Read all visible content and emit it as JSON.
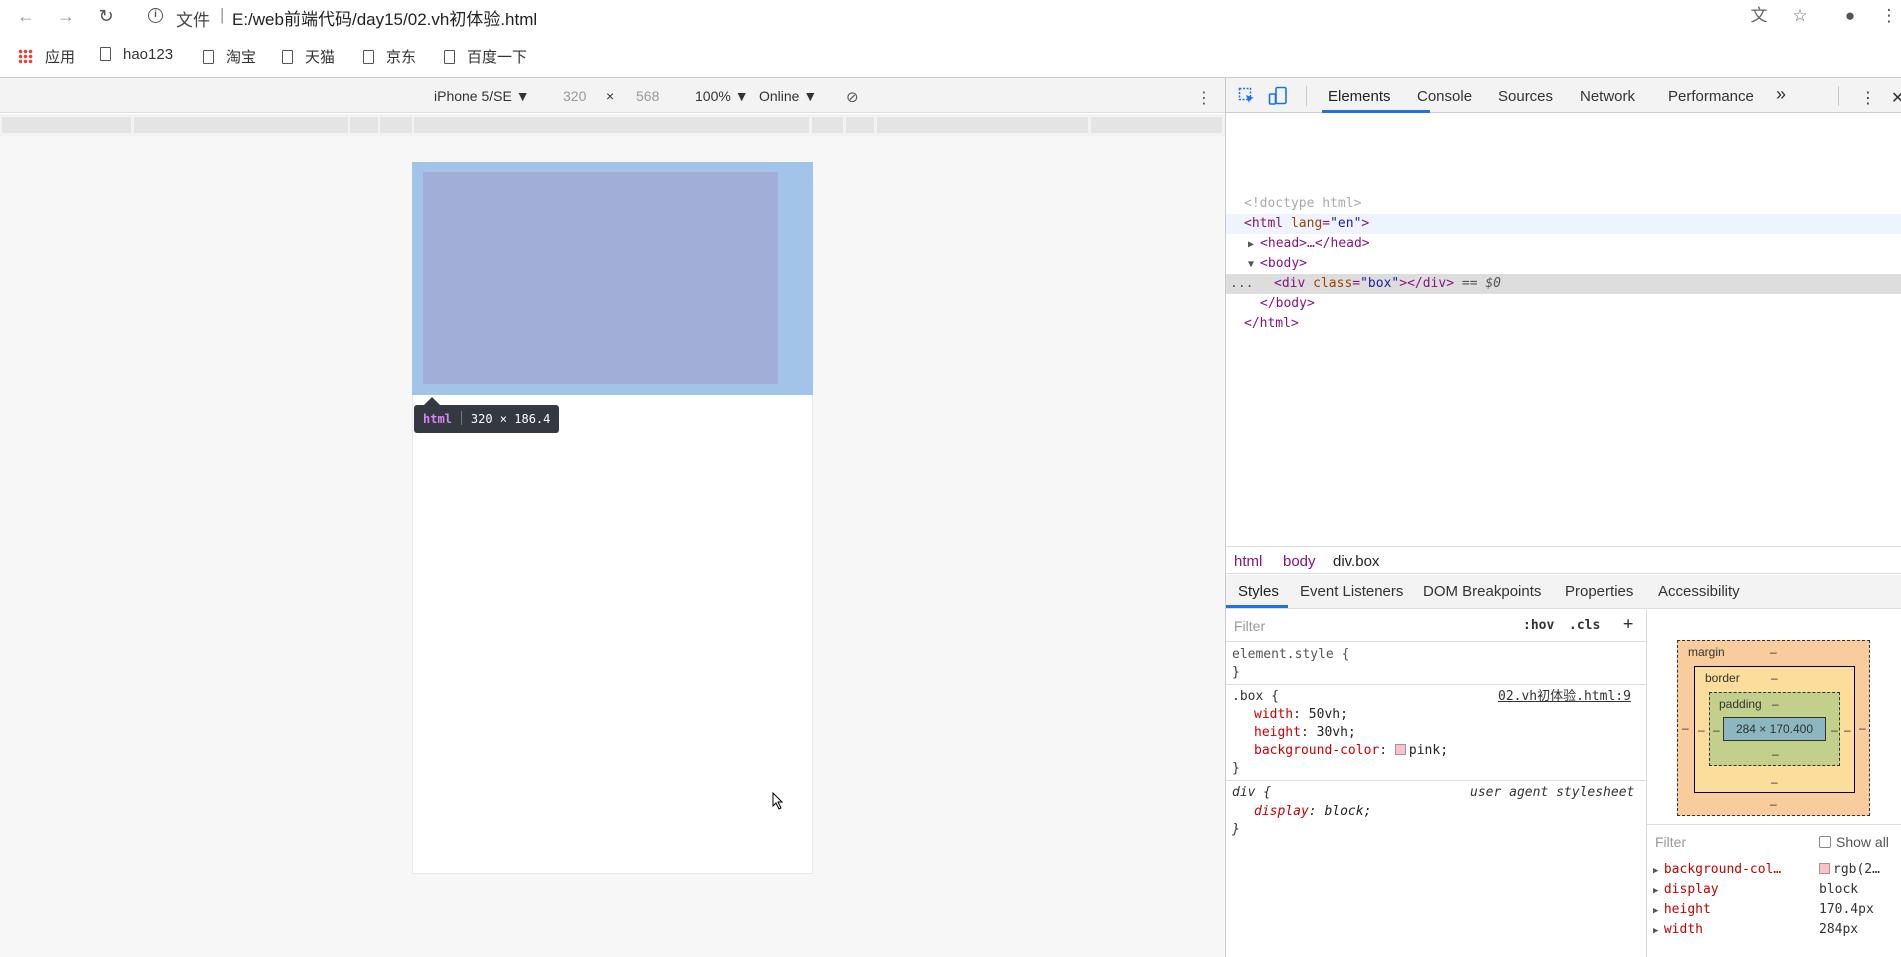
{
  "browser": {
    "file_label": "文件",
    "url": "E:/web前端代码/day15/02.vh初体验.html"
  },
  "bookmarks": [
    {
      "label": "应用"
    },
    {
      "label": "hao123"
    },
    {
      "label": "淘宝"
    },
    {
      "label": "天猫"
    },
    {
      "label": "京东"
    },
    {
      "label": "百度一下"
    }
  ],
  "device_toolbar": {
    "device": "iPhone 5/SE ▼",
    "width": "320",
    "times": "×",
    "height": "568",
    "zoom": "100% ▼",
    "network": "Online ▼"
  },
  "tooltip": {
    "tag": "html",
    "size": "320 × 186.4"
  },
  "devtools": {
    "tabs": [
      "Elements",
      "Console",
      "Sources",
      "Network",
      "Performance"
    ],
    "more": "»",
    "dom_lines": {
      "doctype": "<!doctype html>",
      "html_open": "<html ",
      "html_attr": "lang",
      "html_val": "\"en\"",
      "head": "<head>…</head>",
      "body_open": "<body>",
      "div_open": "<div ",
      "div_attr": "class",
      "div_val": "\"box\"",
      "div_close": "></div>",
      "dollar": " == $0",
      "ellipsis": "...",
      "body_close": "</body>",
      "html_close": "</html>"
    },
    "breadcrumbs": [
      "html",
      "body",
      "div.box"
    ],
    "subtabs": [
      "Styles",
      "Event Listeners",
      "DOM Breakpoints",
      "Properties",
      "Accessibility"
    ],
    "styles": {
      "filter_placeholder": "Filter",
      "hov": ":hov",
      "cls": ".cls",
      "add": "+",
      "element_style": "element.style {",
      "close_brace": "}",
      "box_selector": ".box {",
      "box_source": "02.vh初体验.html:9",
      "box_props": [
        {
          "name": "width",
          "value": "50vh;"
        },
        {
          "name": "height",
          "value": "30vh;"
        },
        {
          "name": "background-color",
          "value": "pink;"
        }
      ],
      "div_selector": "div {",
      "div_source": "user agent stylesheet",
      "div_prop": {
        "name": "display",
        "value": "block;"
      }
    },
    "box_model": {
      "margin": "margin",
      "border": "border",
      "padding": "padding",
      "content": "284 × 170.400",
      "dash": "–"
    },
    "computed": {
      "filter_placeholder": "Filter",
      "show_all": "Show all",
      "rows": [
        {
          "name": "background-col…",
          "value": "rgb(2…"
        },
        {
          "name": "display",
          "value": "block"
        },
        {
          "name": "height",
          "value": "170.4px"
        },
        {
          "name": "width",
          "value": "284px"
        }
      ]
    }
  },
  "colors": {
    "selection_blue": "#1a73e8",
    "margin_highlight": "#a1c4e8",
    "content_highlight": "#a0aed8"
  }
}
